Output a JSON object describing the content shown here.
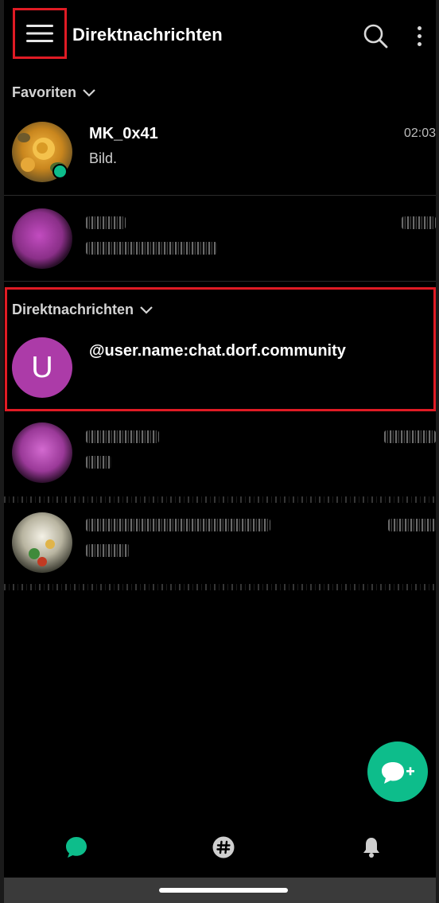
{
  "header": {
    "title": "Direktnachrichten",
    "menu_icon": "hamburger-menu-icon",
    "search_icon": "search-icon",
    "more_icon": "more-vert-icon"
  },
  "favorites": {
    "label": "Favoriten",
    "rooms": [
      {
        "name": "MK_0x41",
        "preview": "Bild.",
        "time": "02:03",
        "avatar": "rose-photo",
        "online": true
      },
      {
        "name": "",
        "preview": "",
        "time": "",
        "avatar": "redacted-purple",
        "online": false
      }
    ]
  },
  "direct_messages": {
    "label": "Direktnachrichten",
    "rooms": [
      {
        "name": "@user.name:chat.dorf.community",
        "preview": "",
        "time": "",
        "avatar_letter": "U",
        "avatar_color": "#ac3ba8"
      },
      {
        "name": "",
        "preview": "",
        "time": "",
        "avatar": "redacted-purple"
      },
      {
        "name": "",
        "preview": "",
        "time": "",
        "avatar": "redacted-photo"
      }
    ]
  },
  "fab": {
    "icon": "new-chat-icon"
  },
  "bottom_nav": {
    "items": [
      {
        "icon": "chat-bubble-icon",
        "active": true
      },
      {
        "icon": "hash-icon",
        "active": false
      },
      {
        "icon": "bell-icon",
        "active": false
      }
    ]
  },
  "colors": {
    "accent": "#0dbd8b",
    "highlight": "#e01b24",
    "avatar_purple": "#ac3ba8",
    "background": "#000000"
  }
}
